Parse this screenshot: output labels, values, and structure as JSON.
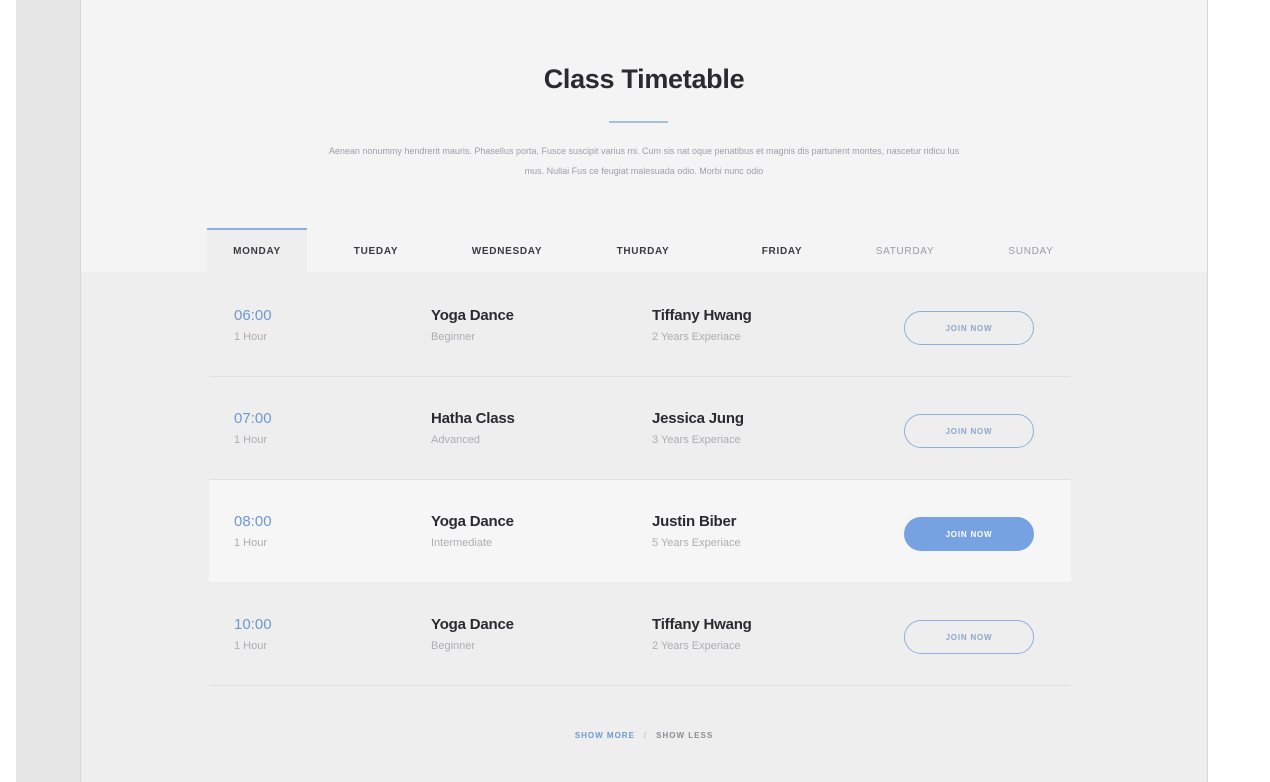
{
  "header": {
    "title": "Class Timetable",
    "description": "Aenean nonummy hendrerit mauris. Phasellus porta. Fusce suscipit varius mi. Cum sis nat oque penatibus et magnis dis parturient montes, nascetur ridicu lus mus. Nullai Fus ce feugiat malesuada odio. Morbi nunc odio"
  },
  "tabs": [
    {
      "label": "MONDAY",
      "active": true
    },
    {
      "label": "TUEDAY",
      "active": false
    },
    {
      "label": "WEDNESDAY",
      "active": false
    },
    {
      "label": "THURDAY",
      "active": false
    },
    {
      "label": "FRIDAY",
      "active": false
    },
    {
      "label": "SATURDAY",
      "active": false
    },
    {
      "label": "SUNDAY",
      "active": false
    }
  ],
  "schedule": [
    {
      "time": "06:00",
      "duration": "1 Hour",
      "class_name": "Yoga Dance",
      "level": "Beginner",
      "trainer": "Tiffany Hwang",
      "experience": "2 Years Experiace",
      "button": "JOIN NOW"
    },
    {
      "time": "07:00",
      "duration": "1 Hour",
      "class_name": "Hatha Class",
      "level": "Advanced",
      "trainer": "Jessica Jung",
      "experience": "3 Years Experiace",
      "button": "JOIN NOW"
    },
    {
      "time": "08:00",
      "duration": "1 Hour",
      "class_name": "Yoga Dance",
      "level": "Intermediate",
      "trainer": "Justin Biber",
      "experience": "5 Years Experiace",
      "button": "JOIN NOW"
    },
    {
      "time": "10:00",
      "duration": "1 Hour",
      "class_name": "Yoga Dance",
      "level": "Beginner",
      "trainer": "Tiffany Hwang",
      "experience": "2 Years Experiace",
      "button": "JOIN NOW"
    }
  ],
  "footer": {
    "show_more": "SHOW MORE",
    "separator": "/",
    "show_less": "SHOW LESS"
  },
  "colors": {
    "accent": "#76a2e2",
    "time_text": "#6d99d1",
    "heading_text": "#2b2b2f",
    "muted_text": "#adaeb2"
  }
}
